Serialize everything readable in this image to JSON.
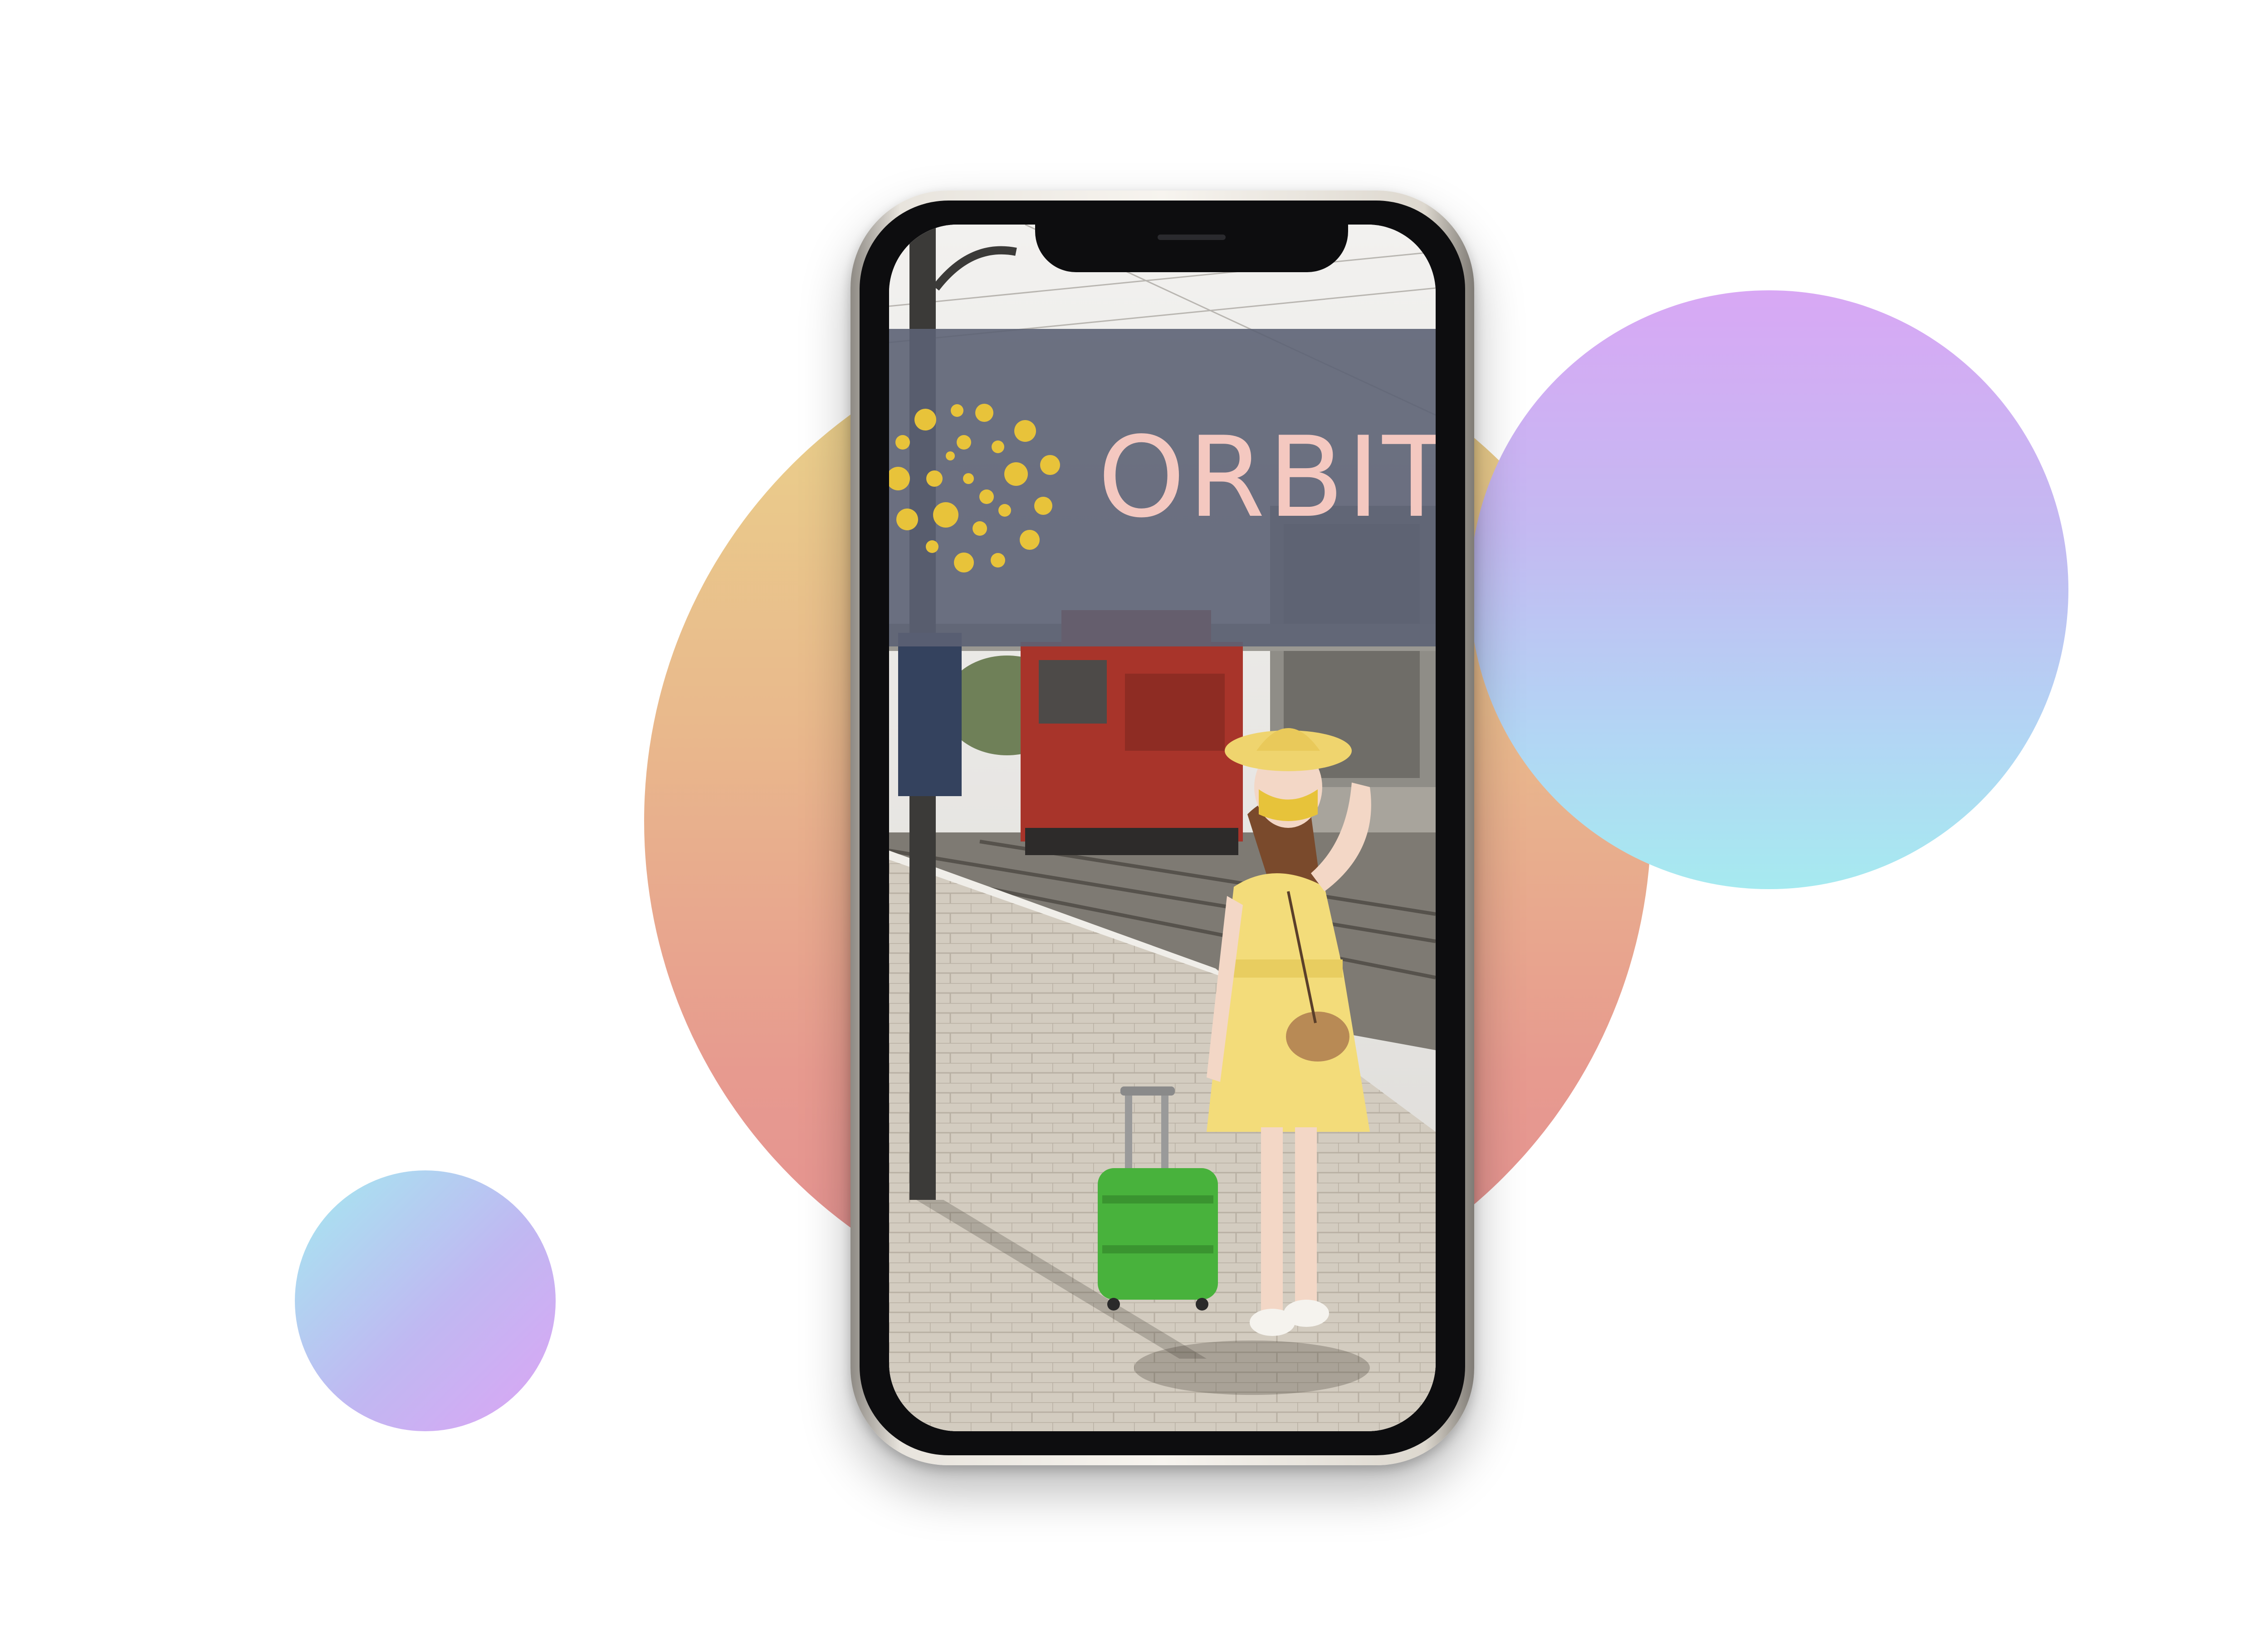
{
  "brand": {
    "name": "ORBIT",
    "name_color": "#f4c8c0",
    "mark_color": "#e8c33a",
    "banner_color": "#5c6274"
  },
  "decor": {
    "bubble_large_colors": [
      "#ead58a",
      "#e49092"
    ],
    "bubble_top_right_colors": [
      "#d8a8f4",
      "#a6eaf0"
    ],
    "bubble_small_colors": [
      "#a4eaf0",
      "#dca4f4"
    ]
  },
  "icons": {
    "logo": "dotted-circle-logo-icon"
  }
}
